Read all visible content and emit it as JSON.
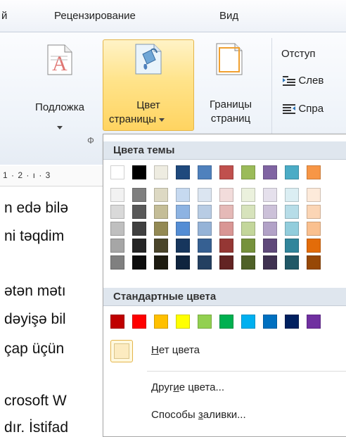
{
  "tabs": [
    {
      "label": "й",
      "partial": true
    },
    {
      "label": "Рецензирование"
    },
    {
      "label": "Вид"
    }
  ],
  "ribbon": {
    "watermark": {
      "label": "Подложка"
    },
    "page_color": {
      "label_line1": "Цвет",
      "label_line2": "страницы"
    },
    "page_borders": {
      "label_line1": "Границы",
      "label_line2": "страниц"
    },
    "indent_group_label": "Отступ",
    "indent_left_label": "Слев",
    "indent_right_label": "Спра",
    "group_label_partial": "Ф"
  },
  "ruler_text": "1 · 2 · ı · 3",
  "document_lines": [
    "n edə bilə",
    "ni təqdim",
    "ətən mətı",
    "dəyişə bil",
    "çap üçün",
    "crosoft W",
    "dır. İstifad"
  ],
  "color_menu": {
    "theme_header": "Цвета темы",
    "standard_header": "Стандартные цвета",
    "no_color": {
      "label_prefix": "",
      "mnemonic": "Н",
      "label_rest": "ет цвета"
    },
    "more_colors": {
      "label_prefix": "Друг",
      "mnemonic": "и",
      "label_rest": "е цвета..."
    },
    "fill_effects": {
      "label_prefix": "Способы ",
      "mnemonic": "з",
      "label_rest": "аливки..."
    },
    "theme_colors": [
      [
        "#FFFFFF",
        "#F2F2F2",
        "#D9D9D9",
        "#BFBFBF",
        "#A6A6A6",
        "#808080"
      ],
      [
        "#000000",
        "#7F7F7F",
        "#595959",
        "#404040",
        "#262626",
        "#0D0D0D"
      ],
      [
        "#EEECE1",
        "#DDD9C3",
        "#C4BD97",
        "#938953",
        "#4A452A",
        "#1D1B10"
      ],
      [
        "#1F497D",
        "#C6D9F0",
        "#8DB3E2",
        "#548DD4",
        "#17365D",
        "#0F243E"
      ],
      [
        "#4F81BD",
        "#DBE5F1",
        "#B8CCE4",
        "#95B3D7",
        "#366092",
        "#244061"
      ],
      [
        "#C0504D",
        "#F2DCDB",
        "#E5B9B7",
        "#D99694",
        "#953734",
        "#632423"
      ],
      [
        "#9BBB59",
        "#EBF1DD",
        "#D7E3BC",
        "#C3D69B",
        "#76923C",
        "#4F6128"
      ],
      [
        "#8064A2",
        "#E5E0EC",
        "#CCC1D9",
        "#B2A2C7",
        "#5F497A",
        "#3F3151"
      ],
      [
        "#4BACC6",
        "#DBEEF3",
        "#B7DDE8",
        "#92CDDC",
        "#31859B",
        "#205867"
      ],
      [
        "#F79646",
        "#FDEADA",
        "#FBD5B5",
        "#FAC08F",
        "#E36C09",
        "#974806"
      ]
    ],
    "standard_colors": [
      "#C00000",
      "#FF0000",
      "#FFC000",
      "#FFFF00",
      "#92D050",
      "#00B050",
      "#00B0F0",
      "#0070C0",
      "#002060",
      "#7030A0"
    ],
    "no_color_swatch": "#FCEBC0",
    "accent_hover": "#FFD461"
  }
}
